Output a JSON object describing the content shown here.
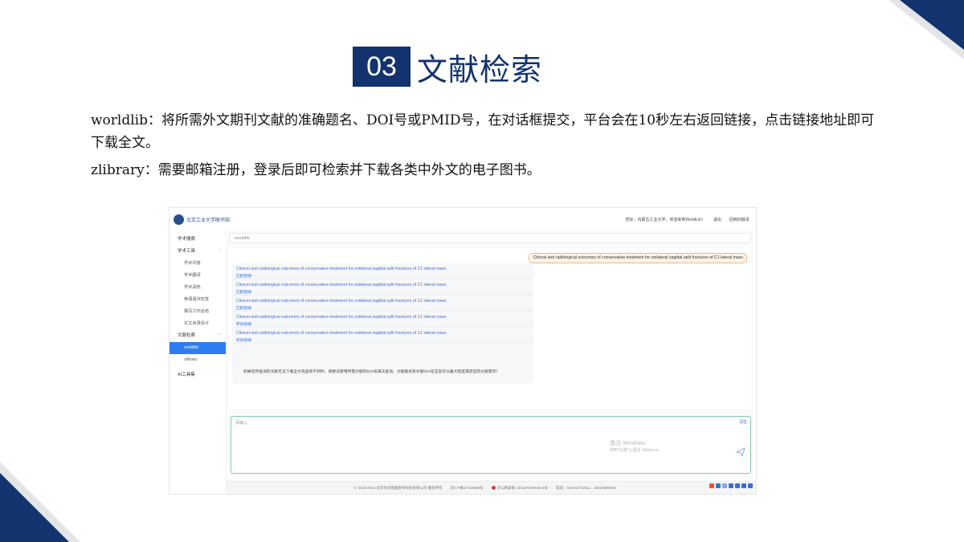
{
  "slide": {
    "number": "03",
    "title": "文献检索",
    "para1": "worldlib：将所需外文期刊文献的准确题名、DOI号或PMID号，在对话框提交，平台会在10秒左右返回链接，点击链接地址即可下载全文。",
    "para2": "zlibrary：需要邮箱注册，登录后即可检索并下载各类中外文的电子图书。"
  },
  "colors": {
    "navy": "#12336e",
    "accent_blue": "#2d7df2"
  },
  "app": {
    "logo_text": "北京工业大学图书馆",
    "header_greeting": "您好，内蒙古工业大学，欢迎来到WorldLib！",
    "logout": "退出",
    "old_version": "回到旧版本",
    "sidebar": {
      "items": [
        {
          "label": "学术搜索"
        },
        {
          "label": "学术工具"
        },
        {
          "label": "学术问答"
        },
        {
          "label": "学术翻译"
        },
        {
          "label": "学术润色"
        },
        {
          "label": "英语语法检查"
        },
        {
          "label": "撰写工作总结"
        },
        {
          "label": "论文目录设计"
        },
        {
          "label": "文献检索"
        },
        {
          "label": "worldlib"
        },
        {
          "label": "zlibrary"
        },
        {
          "label": "AI工具集"
        }
      ]
    },
    "search_label": "worldlib",
    "user_query": "Clinical and radiological outcomes of conservative treatment for unilateral sagittal split fractures of C1 lateral mass",
    "results": [
      {
        "title": "Clinical and radiological outcomes of conservative treatment for unilateral sagittal split fractures of C1 lateral mass",
        "link": "匹配链接"
      },
      {
        "title": "Clinical and radiological outcomes of conservative treatment for unilateral sagittal split fractures of C1 lateral mass",
        "link": "匹配链接"
      },
      {
        "title": "Clinical and radiological outcomes of conservative treatment for unilateral sagittal split fractures of C1 lateral mass",
        "link": "匹配链接"
      },
      {
        "title": "Clinical and radiological outcomes of conservative treatment for unilateral sagittal split fractures of C1 lateral mass",
        "link": "原始链接"
      },
      {
        "title": "Clinical and radiological outcomes of conservative treatment for unilateral sagittal split fractures of C1 lateral mass",
        "link": "原始链接"
      }
    ],
    "bot_note": "如果您所查询的文献无法下载全文或查询不到时，请尝试使用所需文献的DOI号再次查询。文献题名和文献DOI号互查可以最大程度满足您的文献需求！",
    "input_placeholder": "请输入",
    "send_label": "清空",
    "watermark_line1": "激活 Windows",
    "watermark_line2": "转到\"设置\"以激活 Windows。",
    "footer": {
      "copyright": "© 2018-2024 北京你华图版图书科技有限公司 版权所有",
      "icp": "京ICP备17016668号",
      "police": "京公网安备 41010702002643号",
      "phone": "电话：010-63731012、18510860904"
    }
  }
}
